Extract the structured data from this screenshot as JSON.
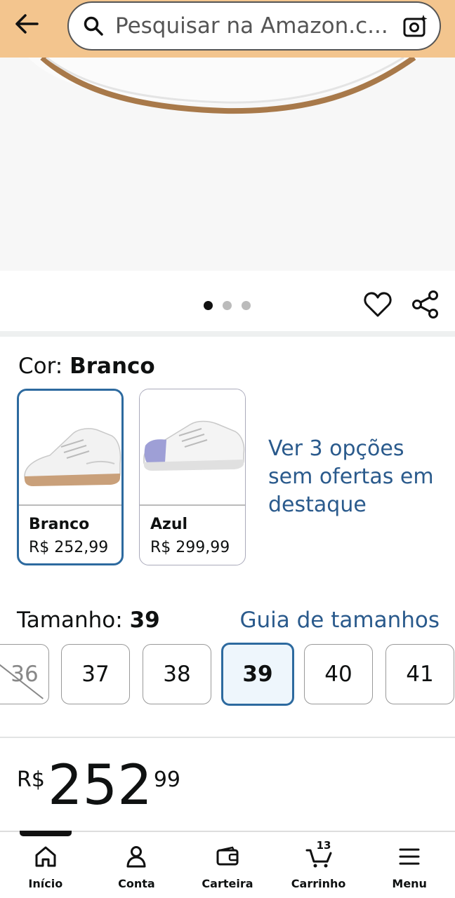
{
  "search": {
    "placeholder": "Pesquisar na Amazon.c..."
  },
  "gallery": {
    "dots": 3,
    "active_dot": 0
  },
  "color": {
    "label": "Cor:",
    "selected": "Branco"
  },
  "swatches": [
    {
      "name": "Branco",
      "price": "R$ 252,99"
    },
    {
      "name": "Azul",
      "price": "R$ 299,99"
    }
  ],
  "more_options": "Ver 3 opções sem ofertas em destaque",
  "size": {
    "label": "Tamanho:",
    "selected": "39",
    "guide": "Guia de tamanhos"
  },
  "sizes": [
    "36",
    "37",
    "38",
    "39",
    "40",
    "41"
  ],
  "price": {
    "currency": "R$",
    "whole": "252",
    "cents": "99"
  },
  "nav": {
    "home": "Início",
    "account": "Conta",
    "wallet": "Carteira",
    "cart": "Carrinho",
    "cart_count": "13",
    "menu": "Menu"
  },
  "colors": {
    "accent": "#2d6a9f",
    "link": "#2a5a8c",
    "header": "#f3c58e"
  }
}
